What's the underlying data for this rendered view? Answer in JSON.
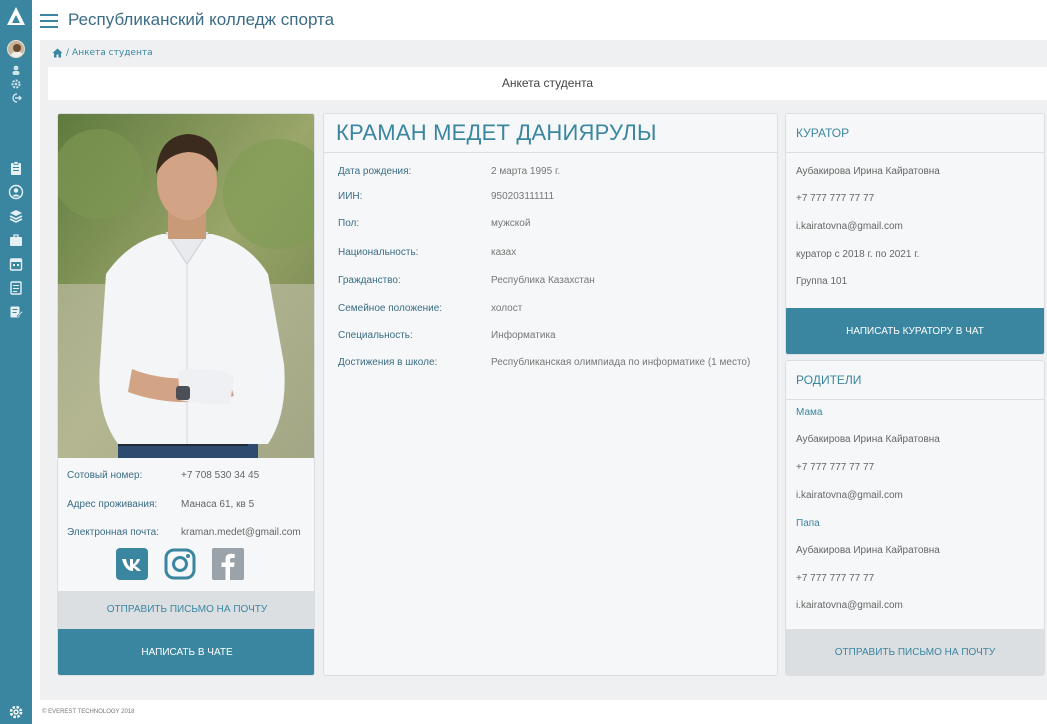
{
  "app": {
    "title": "Республиканский колледж спорта"
  },
  "breadcrumb": {
    "separator": "/",
    "current": "Анкета студента"
  },
  "page": {
    "heading": "Анкета студента"
  },
  "profile": {
    "contacts": [
      {
        "label": "Сотовый номер:",
        "value": "+7 708 530 34 45"
      },
      {
        "label": "Адрес проживания:",
        "value": "Манаса 61, кв 5"
      },
      {
        "label": "Электронная почта:",
        "value": "kraman.medet@gmail.com"
      }
    ],
    "socials": [
      "vk-icon",
      "instagram-icon",
      "facebook-icon"
    ],
    "send_mail_label": "ОТПРАВИТЬ ПИСЬМО НА ПОЧТУ",
    "chat_label": "НАПИСАТЬ В ЧАТЕ"
  },
  "student": {
    "name": "КРАМАН МЕДЕТ ДАНИЯРУЛЫ",
    "fields": [
      {
        "label": "Дата рождения:",
        "value": "2 марта 1995 г."
      },
      {
        "label": "ИИН:",
        "value": "950203111111"
      },
      {
        "label": "Пол:",
        "value": "мужской"
      },
      {
        "label": "Национальность:",
        "value": "казах"
      },
      {
        "label": "Гражданство:",
        "value": "Республика Казахстан"
      },
      {
        "label": "Семейное положение:",
        "value": "холост"
      },
      {
        "label": "Специальность:",
        "value": "Информатика"
      },
      {
        "label": "Достижения в школе:",
        "value": "Республиканская олимпиада по информатике (1 место)"
      }
    ]
  },
  "curator": {
    "title": "КУРАТОР",
    "name": "Аубакирова Ирина Кайратовна",
    "phone": "+7 777 777 77 77",
    "email": "i.kairatovna@gmail.com",
    "period": "куратор с 2018 г. по 2021 г.",
    "group": "Группа 101",
    "chat_label": "НАПИСАТЬ КУРАТОРУ В ЧАТ"
  },
  "parents": {
    "title": "РОДИТЕЛИ",
    "mother": {
      "role": "Мама",
      "name": "Аубакирова Ирина Кайратовна",
      "phone": "+7 777 777 77 77",
      "email": "i.kairatovna@gmail.com"
    },
    "father": {
      "role": "Папа",
      "name": "Аубакирова Ирина Кайратовна",
      "phone": "+7 777 777 77 77",
      "email": "i.kairatovna@gmail.com"
    },
    "send_mail_label": "ОТПРАВИТЬ ПИСЬМО НА ПОЧТУ"
  },
  "footer": {
    "copyright": "© EVEREST TECHNOLOGY 2018"
  },
  "colors": {
    "accent": "#3a86a0",
    "rail": "#3a86a0",
    "button_gray": "#dcdfe2",
    "page_bg": "#eef0f2"
  }
}
